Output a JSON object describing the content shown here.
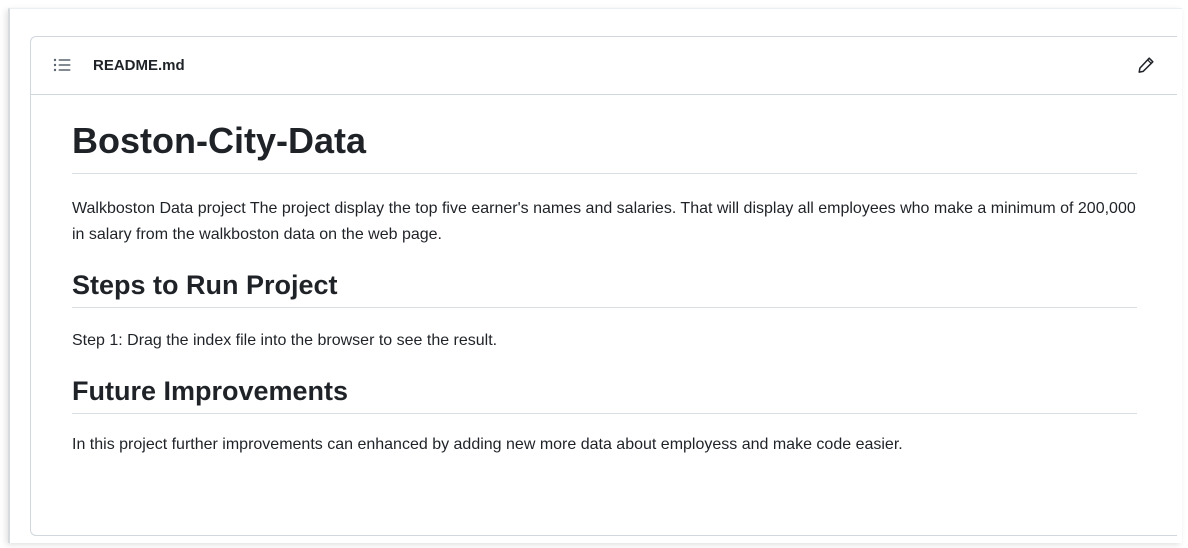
{
  "readme": {
    "file_name": "README.md",
    "title": "Boston-City-Data",
    "intro": "Walkboston Data project The project display the top five earner's names and salaries. That will display all employees who make a minimum of 200,000 in salary from the walkboston data on the web page.",
    "sections": [
      {
        "heading": "Steps to Run Project",
        "text": "Step 1: Drag the index file into the browser to see the result."
      },
      {
        "heading": "Future Improvements",
        "text": "In this project further improvements can enhanced by adding new more data about employess and make code easier."
      }
    ]
  },
  "icons": {
    "outline": "list-outline-icon",
    "edit": "pencil-icon"
  },
  "colors": {
    "text": "#1f2328",
    "border": "#d0d7de",
    "icon": "#59636e"
  }
}
